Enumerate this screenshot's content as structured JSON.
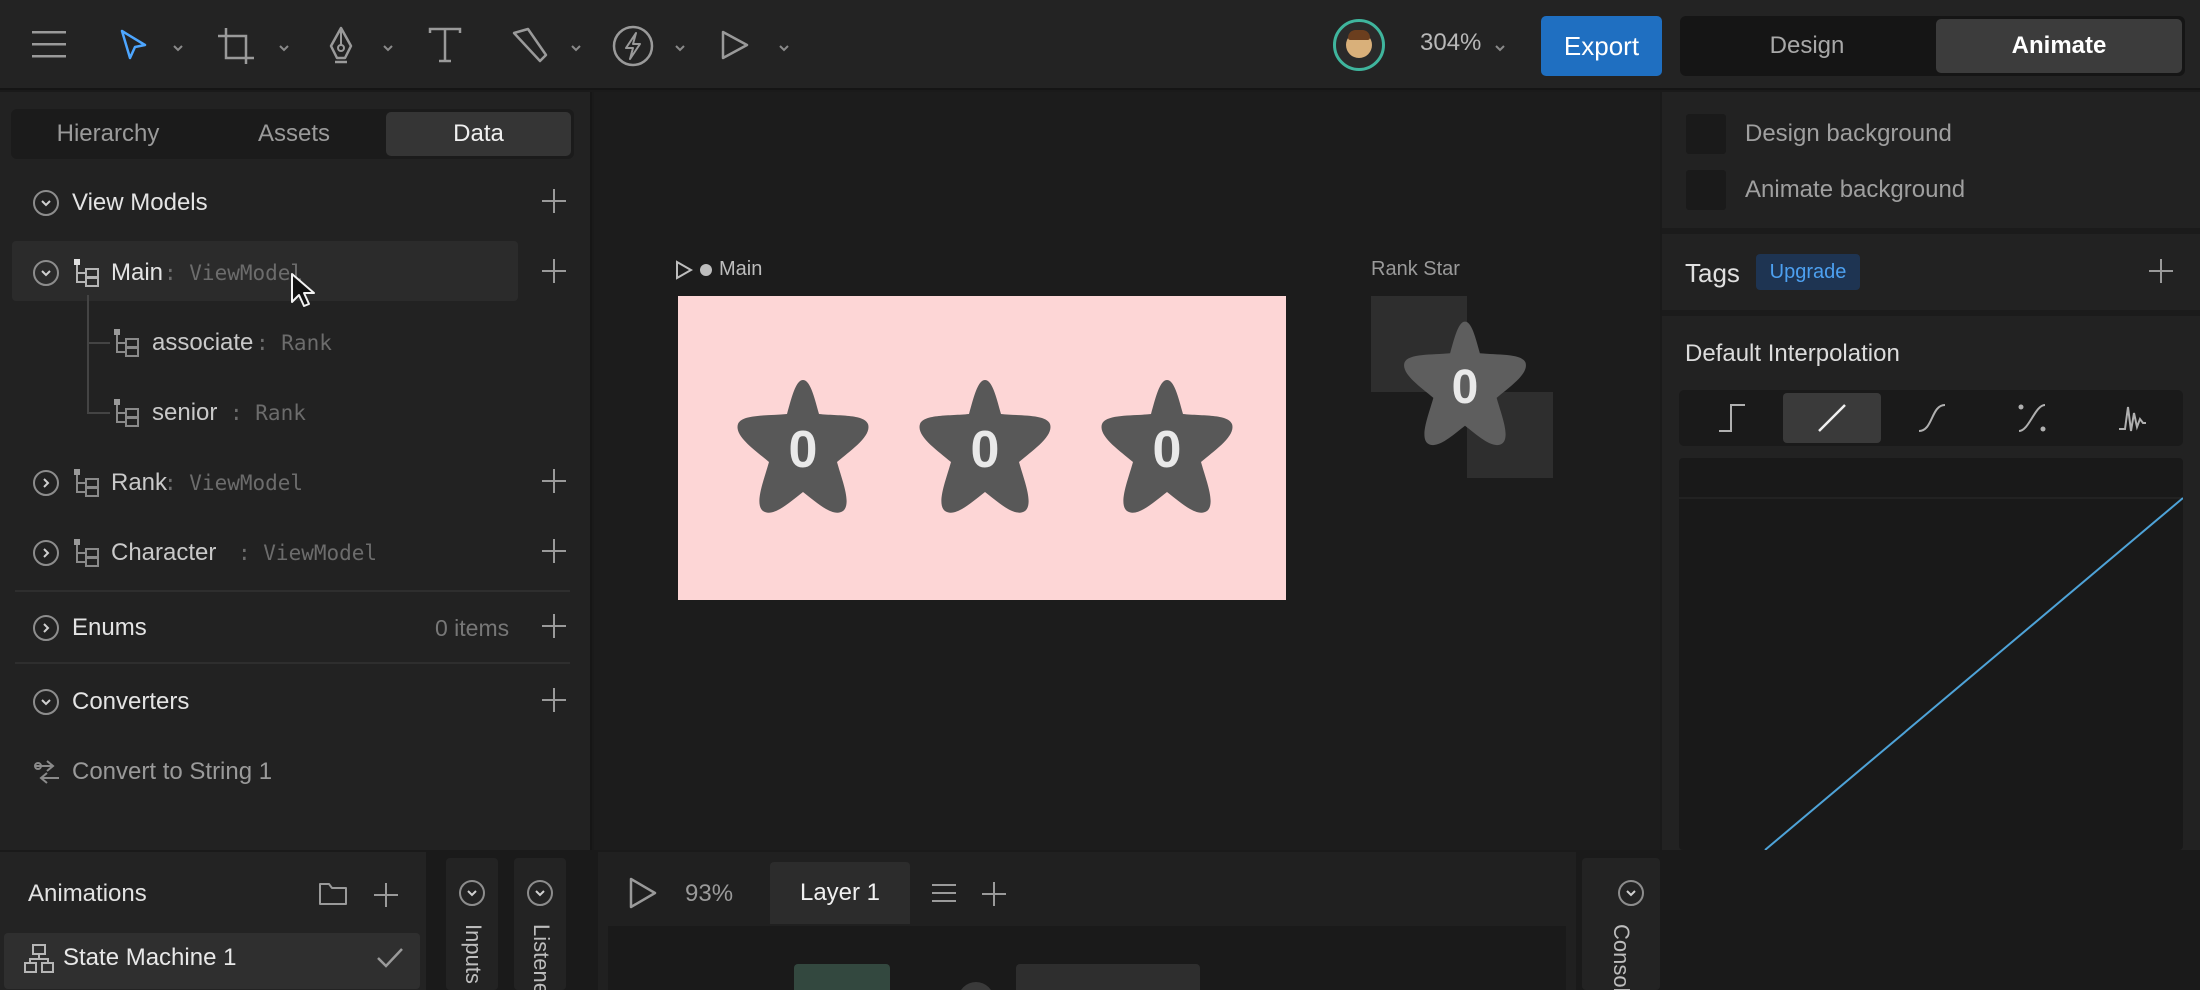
{
  "toolbar": {
    "menu_icon": "hamburger-icon",
    "tools": [
      "select-tool",
      "frame-tool",
      "pen-tool",
      "text-tool",
      "shape-tool",
      "bolt-tool",
      "play-tool"
    ],
    "zoom": "304%",
    "export_label": "Export",
    "modes": [
      "Design",
      "Animate"
    ],
    "active_mode": "Animate"
  },
  "left_panel": {
    "tabs": [
      "Hierarchy",
      "Assets",
      "Data"
    ],
    "active_tab": "Data",
    "view_models_label": "View Models",
    "view_models": [
      {
        "name": "Main",
        "type": ": ViewModel",
        "expanded": true,
        "children": [
          {
            "name": "associate",
            "type": ": Rank"
          },
          {
            "name": "senior",
            "type": ": Rank"
          }
        ]
      },
      {
        "name": "Rank",
        "type": ": ViewModel",
        "expanded": false
      },
      {
        "name": "Character",
        "type": ": ViewModel",
        "expanded": false
      }
    ],
    "enums_label": "Enums",
    "enums_count": "0 items",
    "converters_label": "Converters",
    "converters": [
      "Convert to String 1"
    ]
  },
  "canvas": {
    "main_artboard_title": "Main",
    "main_artboard_bg": "#fdd6d6",
    "stars": [
      "0",
      "0",
      "0"
    ],
    "rank_star_title": "Rank Star",
    "rank_star_value": "0"
  },
  "right_panel": {
    "backgrounds": [
      "Design background",
      "Animate background"
    ],
    "tags_label": "Tags",
    "upgrade_label": "Upgrade",
    "interpolation_label": "Default Interpolation",
    "interpolation_options": [
      "hold",
      "linear",
      "cubic",
      "custom-cubic",
      "elastic"
    ],
    "active_interpolation": "linear",
    "curve_color": "#4ea3d8"
  },
  "bottom": {
    "animations_label": "Animations",
    "state_machine": "State Machine 1",
    "inputs_label": "Inputs",
    "listeners_label": "Listeners",
    "timeline_pct": "93%",
    "layer_label": "Layer 1",
    "console_label": "Console"
  }
}
